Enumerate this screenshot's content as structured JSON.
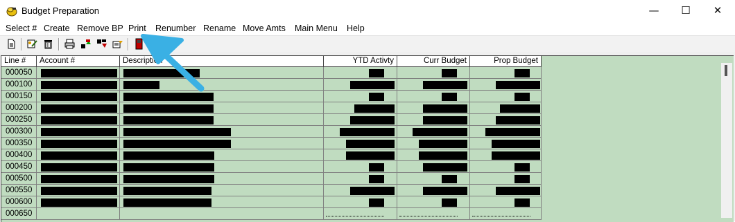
{
  "window": {
    "title": "Budget Preparation",
    "min_glyph": "—",
    "max_glyph": "☐",
    "close_glyph": "✕"
  },
  "menu": [
    "Select #",
    "Create",
    "Remove BP",
    "Print",
    "Renumber",
    "Rename",
    "Move Amts",
    "Main Menu",
    "Help"
  ],
  "toolbar": {
    "buttons": [
      "new-document-icon",
      "edit-tool-icon",
      "trash-icon",
      "print-icon",
      "move-up-icon",
      "move-down-icon",
      "transfer-icon",
      "exit-door-icon"
    ]
  },
  "grid": {
    "headers": {
      "line": "Line #",
      "account": "Account #",
      "description": "Description",
      "ytd": "YTD Activty",
      "curr": "Curr Budget",
      "prop": "Prop Budget"
    },
    "rows": [
      {
        "line": "000050"
      },
      {
        "line": "000100"
      },
      {
        "line": "000150"
      },
      {
        "line": "000200"
      },
      {
        "line": "000250"
      },
      {
        "line": "000300"
      },
      {
        "line": "000350"
      },
      {
        "line": "000400"
      },
      {
        "line": "000450"
      },
      {
        "line": "000500"
      },
      {
        "line": "000550"
      },
      {
        "line": "000600"
      },
      {
        "line": "000650"
      }
    ]
  },
  "colors": {
    "grid_bg": "#c0dcc0",
    "annotation_arrow": "#3ab0e4"
  }
}
